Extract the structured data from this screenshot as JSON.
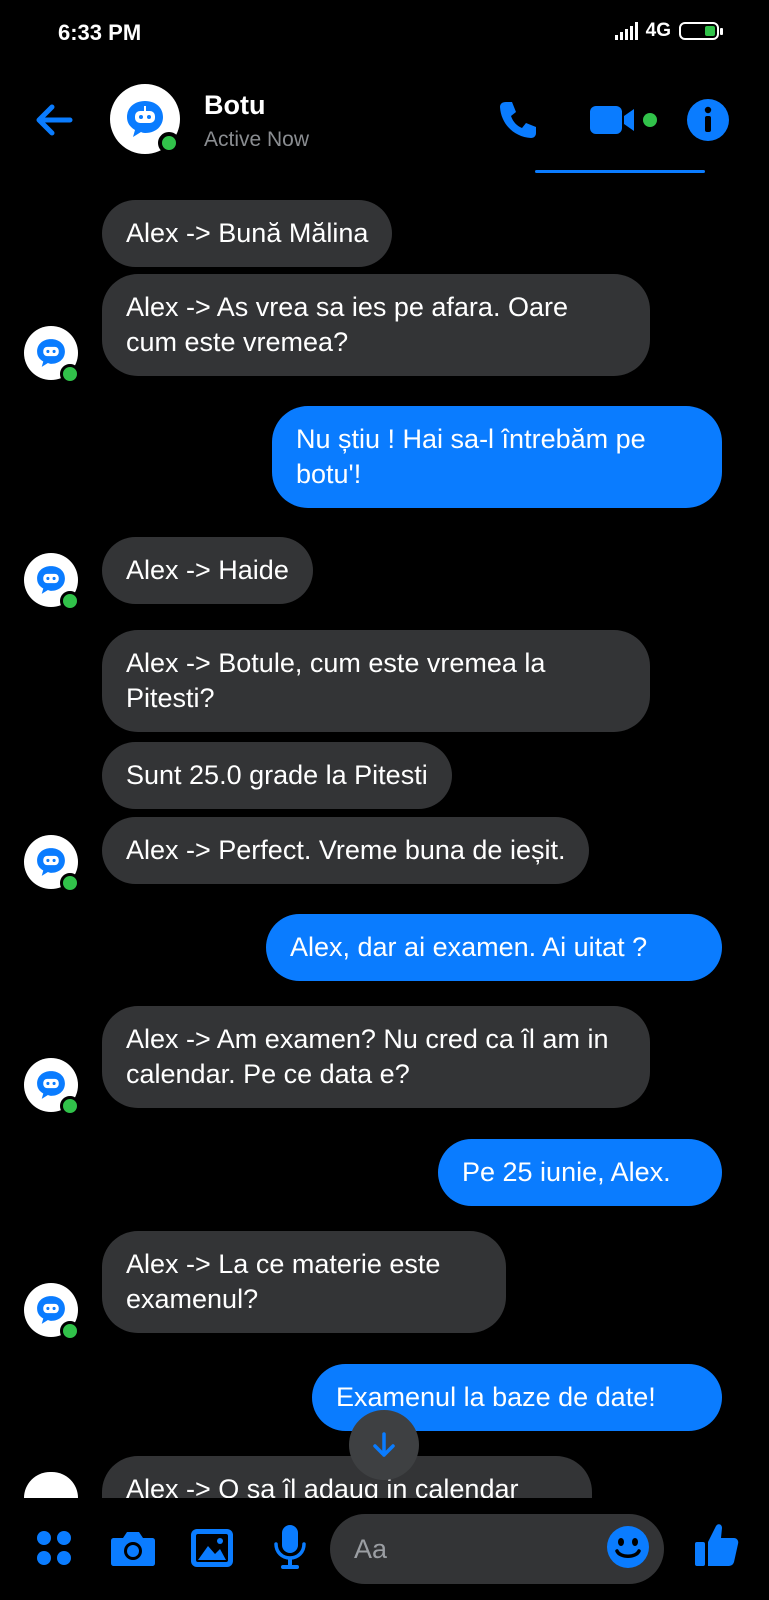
{
  "status_bar": {
    "time": "6:33 PM",
    "network": "4G"
  },
  "header": {
    "name": "Botu",
    "status": "Active Now"
  },
  "colors": {
    "accent": "#0a7cff",
    "received_bubble": "#333436",
    "presence": "#31c24a"
  },
  "messages": [
    {
      "dir": "in",
      "text": "Alex -> Bună Mălina"
    },
    {
      "dir": "in",
      "text": "Alex -> As vrea sa ies pe afara. Oare cum este vremea?"
    },
    {
      "dir": "out",
      "text": "Nu știu ! Hai sa-l întrebăm pe botu'!"
    },
    {
      "dir": "in",
      "text": "Alex -> Haide"
    },
    {
      "dir": "in",
      "text": "Alex -> Botule, cum este vremea la Pitesti?"
    },
    {
      "dir": "in",
      "text": "Sunt 25.0 grade la Pitesti"
    },
    {
      "dir": "in",
      "text": "Alex -> Perfect. Vreme buna de ieșit."
    },
    {
      "dir": "out",
      "text": "Alex, dar ai examen. Ai uitat ?"
    },
    {
      "dir": "in",
      "text": "Alex -> Am examen? Nu cred ca îl am in calendar. Pe ce data e?"
    },
    {
      "dir": "out",
      "text": "Pe 25 iunie, Alex."
    },
    {
      "dir": "in",
      "text": "Alex -> La ce materie este examenul?"
    },
    {
      "dir": "out",
      "text": "Examenul la baze de date!"
    },
    {
      "dir": "in",
      "text": "Alex -> O sa îl adaug in calendar"
    }
  ],
  "composer": {
    "placeholder": "Aa"
  },
  "icons": {
    "back": "arrow-left-icon",
    "call": "phone-icon",
    "video": "video-camera-icon",
    "info": "info-icon",
    "apps": "four-dots-icon",
    "camera": "camera-icon",
    "gallery": "image-icon",
    "voice": "microphone-icon",
    "emoji": "smiley-icon",
    "like": "thumbs-up-icon",
    "scroll": "arrow-down-icon"
  }
}
